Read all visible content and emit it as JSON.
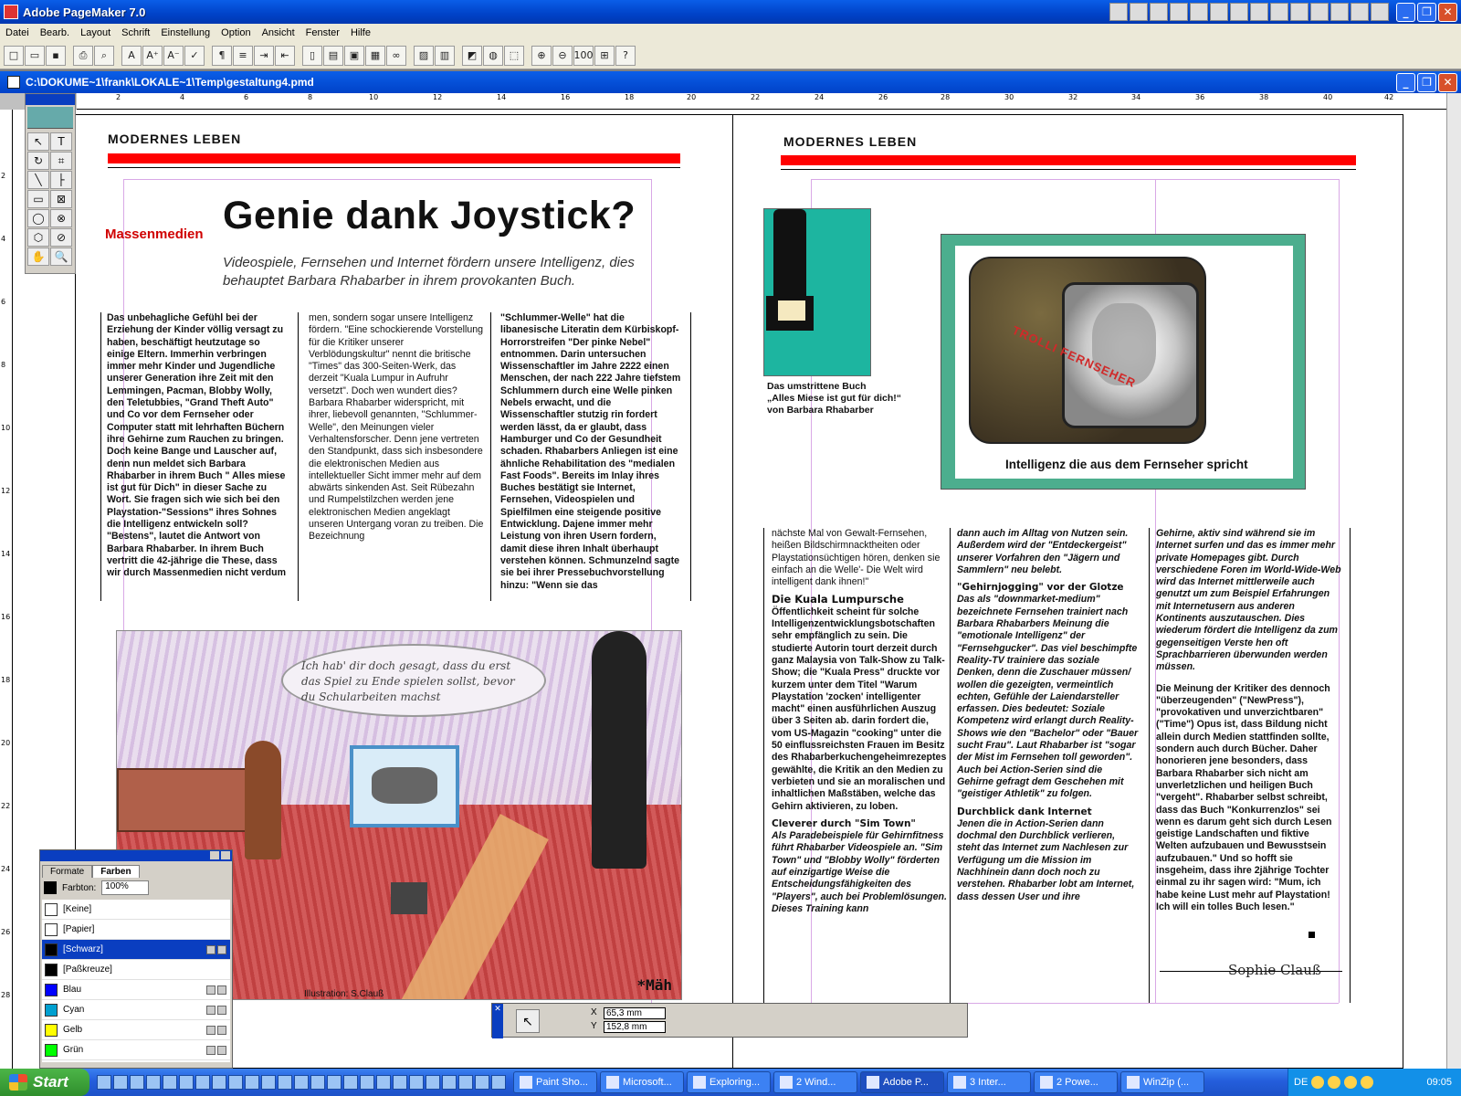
{
  "app": {
    "title": "Adobe PageMaker 7.0",
    "window_buttons": [
      "_",
      "❐",
      "✕"
    ]
  },
  "menu": [
    "Datei",
    "Bearb.",
    "Layout",
    "Schrift",
    "Einstellung",
    "Option",
    "Ansicht",
    "Fenster",
    "Hilfe"
  ],
  "toolbar": {
    "buttons": [
      "new",
      "open",
      "save",
      "print",
      "find",
      "A",
      "A+",
      "A-",
      "spell",
      "¶",
      "list",
      "indent",
      "outdent",
      "page",
      "doc",
      "frame",
      "tb",
      "link",
      "img",
      "chart",
      "photo",
      "globe",
      "pdf",
      "zoom-in",
      "zoom-out",
      "100",
      "fit",
      "?"
    ]
  },
  "document": {
    "path": "C:\\DOKUME~1\\frank\\LOKALE~1\\Temp\\gestaltung4.pmd",
    "ruler_top_marks": [
      "2",
      "4",
      "6",
      "8",
      "10",
      "12",
      "14",
      "16",
      "18",
      "20",
      "22",
      "24",
      "26",
      "28",
      "30",
      "32",
      "34",
      "36",
      "38",
      "40",
      "42"
    ],
    "ruler_left_marks": [
      "2",
      "4",
      "6",
      "8",
      "10",
      "12",
      "14",
      "16",
      "18",
      "20",
      "22",
      "24",
      "26",
      "28"
    ]
  },
  "left_page": {
    "section": "MODERNES LEBEN",
    "rubric": "Massenmedien",
    "headline": "Genie dank Joystick?",
    "subline": "Videospiele, Fernsehen und Internet fördern unsere Intelligenz, dies behauptet Barbara Rhabarber in ihrem provokanten Buch.",
    "col1": "Das unbehagliche Gefühl bei der Erziehung der Kinder völlig versagt zu haben, beschäftigt heutzutage so einige Eltern. Immerhin verbringen immer mehr Kinder und Jugendliche unserer Generation ihre Zeit mit den Lemmingen, Pacman, Blobby Wolly, den Teletubbies, \"Grand Theft Auto\" und Co vor dem Fernseher oder Computer statt mit lehrhaften Büchern ihre Gehirne zum Rauchen zu bringen. Doch keine Bange und Lauscher auf, denn nun meldet sich Barbara Rhabarber in ihrem Buch \" Alles miese ist gut für Dich\" in dieser Sache zu Wort. Sie fragen sich wie sich bei den Playstation-\"Sessions\" ihres Sohnes die Intelligenz entwickeln soll? \"Bestens\", lautet die Antwort von Barbara Rhabarber. In ihrem Buch vertritt die 42-jährige die These, dass wir durch Massenmedien nicht verdum",
    "col2": "men, sondern sogar unsere Intelligenz fördern. \"Eine schockierende Vorstellung für die Kritiker unserer Verblödungskultur\" nennt die britische \"Times\" das 300-Seiten-Werk, das derzeit \"Kuala Lumpur in Aufruhr versetzt\". Doch wen wundert dies? Barbara Rhabarber widerspricht, mit ihrer, liebevoll genannten, \"Schlummer-Welle\", den Meinungen vieler Verhaltensforscher. Denn jene vertreten den Standpunkt, dass sich insbesondere die elektronischen Medien aus intellektueller Sicht immer mehr auf dem abwärts sinkenden Ast. Seit Rübezahn und Rumpelstilzchen werden jene elektronischen Medien angeklagt unseren Untergang voran zu treiben. Die Bezeichnung",
    "col3": "\"Schlummer-Welle\" hat die libanesische Literatin dem Kürbiskopf-Horrorstreifen \"Der pinke Nebel\" entnommen. Darin untersuchen Wissenschaftler im Jahre 2222 einen Menschen, der nach 222 Jahre tiefstem Schlummern durch eine Welle pinken Nebels erwacht, und die Wissenschaftler stutzig rin fordert werden lässt, da er glaubt, dass Hamburger und Co der Gesundheit schaden. Rhabarbers Anliegen ist eine ähnliche Rehabilitation des \"medialen Fast Foods\". Bereits im Inlay ihres Buches bestätigt sie Internet, Fernsehen, Videospielen und Spielfilmen eine steigende positive Entwicklung. Dajene immer mehr Leistung von ihren Usern fordern, damit diese ihren Inhalt überhaupt verstehen können. Schmunzelnd sagte sie bei ihrer Pressebuchvorstellung hinzu: \"Wenn sie das",
    "illustration_bubble": "Ich hab' dir doch gesagt, dass du erst das Spiel zu Ende spielen sollst, bevor du Schularbeiten machst",
    "illustration_sign": "*Mäh",
    "illustration_caption": "Illustration: S.Clauß"
  },
  "right_page": {
    "section": "MODERNES LEBEN",
    "book_caption": [
      "Das umstrittene Buch",
      "„Alles Miese ist gut für dich!“",
      "von Barbara Rhabarber"
    ],
    "tv_stamp": "TROLLI FERNSEHER",
    "tv_caption": "Intelligenz die aus dem Fernseher spricht",
    "col1_intro": "nächste Mal von Gewalt-Fernsehen, heißen Bildschirmnacktheiten oder Playstationsüchtigen hören, denken sie einfach an die Welle'- Die Welt wird intelligent dank ihnen!\"",
    "col1_head": "Die Kuala Lumpursche",
    "col1_body": "Öffentlichkeit scheint für solche Intelligenzentwicklungsbotschaften sehr empfänglich zu sein. Die studierte Autorin tourt derzeit durch ganz Malaysia von Talk-Show zu Talk-Show; die \"Kuala Press\" druckte vor kurzem unter dem Titel \"Warum Playstation 'zocken' intelligenter macht\" einen ausführlichen Auszug über 3 Seiten ab. darin fordert die, vom US-Magazin \"cooking\" unter die 50 einflussreichsten Frauen im Besitz des Rhabarberkuchengeheimrezeptes gewählte, die Kritik an den Medien zu verbieten und sie an moralischen und inhaltlichen Maßstäben, welche das Gehirn aktivieren, zu loben.",
    "col1_head2": "Cleverer durch \"Sim Town\"",
    "col1_body2": "Als Paradebeispiele für Gehirnfitness führt Rhabarber Videospiele an. \"Sim Town\" und \"Blobby Wolly\" förderten auf einzigartige Weise die Entscheidungsfähigkeiten des \"Players\", auch bei Problemlösungen. Dieses Training kann",
    "col2_body": "dann auch im Alltag von Nutzen sein. Außerdem wird der \"Entdeckergeist\" unserer Vorfahren den \"Jägern und Sammlern\" neu belebt.",
    "col2_head": "\"Gehirnjogging\" vor der Glotze",
    "col2_body2": "Das als \"downmarket-medium\" bezeichnete Fernsehen trainiert nach Barbara Rhabarbers Meinung die \"emotionale Intelligenz\" der \"Fernsehgucker\". Das viel beschimpfte Reality-TV trainiere das soziale Denken, denn die Zuschauer müssen/ wollen die gezeigten, vermeintlich echten, Gefühle der Laiendarsteller erfassen. Dies bedeutet: Soziale Kompetenz wird erlangt durch Reality-Shows wie den \"Bachelor\" oder \"Bauer sucht Frau\". Laut Rhabarber ist \"sogar der Mist im Fernsehen toll geworden\". Auch bei Action-Serien sind die Gehirne gefragt dem Geschehen mit \"geistiger Athletik\" zu folgen.",
    "col2_head2": "Durchblick dank Internet",
    "col2_body3": "Jenen die in Action-Serien dann dochmal den Durchblick verlieren, steht das Internet zum Nachlesen zur Verfügung um die Mission im Nachhinein dann doch noch zu verstehen. Rhabarber lobt am Internet, dass dessen User und ihre",
    "col3_body": "Gehirne, aktiv sind während sie im Internet surfen und das es immer mehr private Homepages gibt. Durch verschiedene Foren im World-Wide-Web wird das Internet mittlerweile auch genutzt um zum Beispiel Erfahrungen mit Internetusern aus anderen Kontinents auszutauschen. Dies wiederum fördert die Intelligenz da zum gegenseitigen Verste hen oft Sprachbarrieren überwunden werden müssen.",
    "col3_body2": "Die Meinung der Kritiker des dennoch \"überzeugenden\" (\"NewPress\"), \"provokativen und unverzichtbaren\" (\"Time\") Opus ist, dass Bildung nicht allein durch Medien stattfinden sollte, sondern auch durch Bücher. Daher honorieren jene besonders, dass Barbara Rhabarber sich nicht am unverletzlichen und heiligen Buch \"vergeht\". Rhabarber selbst schreibt, dass das Buch \"Konkurrenzlos\" sei wenn es darum geht sich durch Lesen geistige Landschaften und fiktive Welten aufzubauen und Bewusstsein aufzubauen.\" Und so hofft sie insgeheim, dass ihre 2jährige Tochter einmal zu ihr sagen wird: \"Mum, ich habe keine Lust mehr auf Playstation! Ich will ein tolles Buch lesen.\"",
    "signature": "Sophie Clauß"
  },
  "toolbox": {
    "tools": [
      "↖",
      "T",
      "↻",
      "⌗",
      "╲",
      "├",
      "▭",
      "⊠",
      "◯",
      "⊗",
      "⬡",
      "⊘",
      "✋",
      "🔍"
    ]
  },
  "colors_palette": {
    "tabs": [
      "Formate",
      "Farben"
    ],
    "active_tab": "Farben",
    "tint_label": "Farbton:",
    "tint_value": "100%",
    "items": [
      {
        "name": "[Keine]",
        "color": "#ffffff"
      },
      {
        "name": "[Papier]",
        "color": "#ffffff"
      },
      {
        "name": "[Schwarz]",
        "color": "#000000"
      },
      {
        "name": "[Paßkreuze]",
        "color": "#000000"
      },
      {
        "name": "Blau",
        "color": "#0000ff"
      },
      {
        "name": "Cyan",
        "color": "#00a0d0"
      },
      {
        "name": "Gelb",
        "color": "#ffff00"
      },
      {
        "name": "Grün",
        "color": "#00ff00"
      }
    ],
    "selected": "[Schwarz]"
  },
  "control_palette": {
    "x_label": "X",
    "x_value": "65,3 mm",
    "y_label": "Y",
    "y_value": "152,8 mm"
  },
  "taskbar": {
    "start": "Start",
    "tasks": [
      "Paint Sho...",
      "Microsoft...",
      "Exploring...",
      "2 Wind...",
      "Adobe P...",
      "3 Inter...",
      "2 Powe...",
      "WinZip (..."
    ],
    "active_task": "Adobe P...",
    "lang": "DE",
    "clock": "09:05"
  }
}
